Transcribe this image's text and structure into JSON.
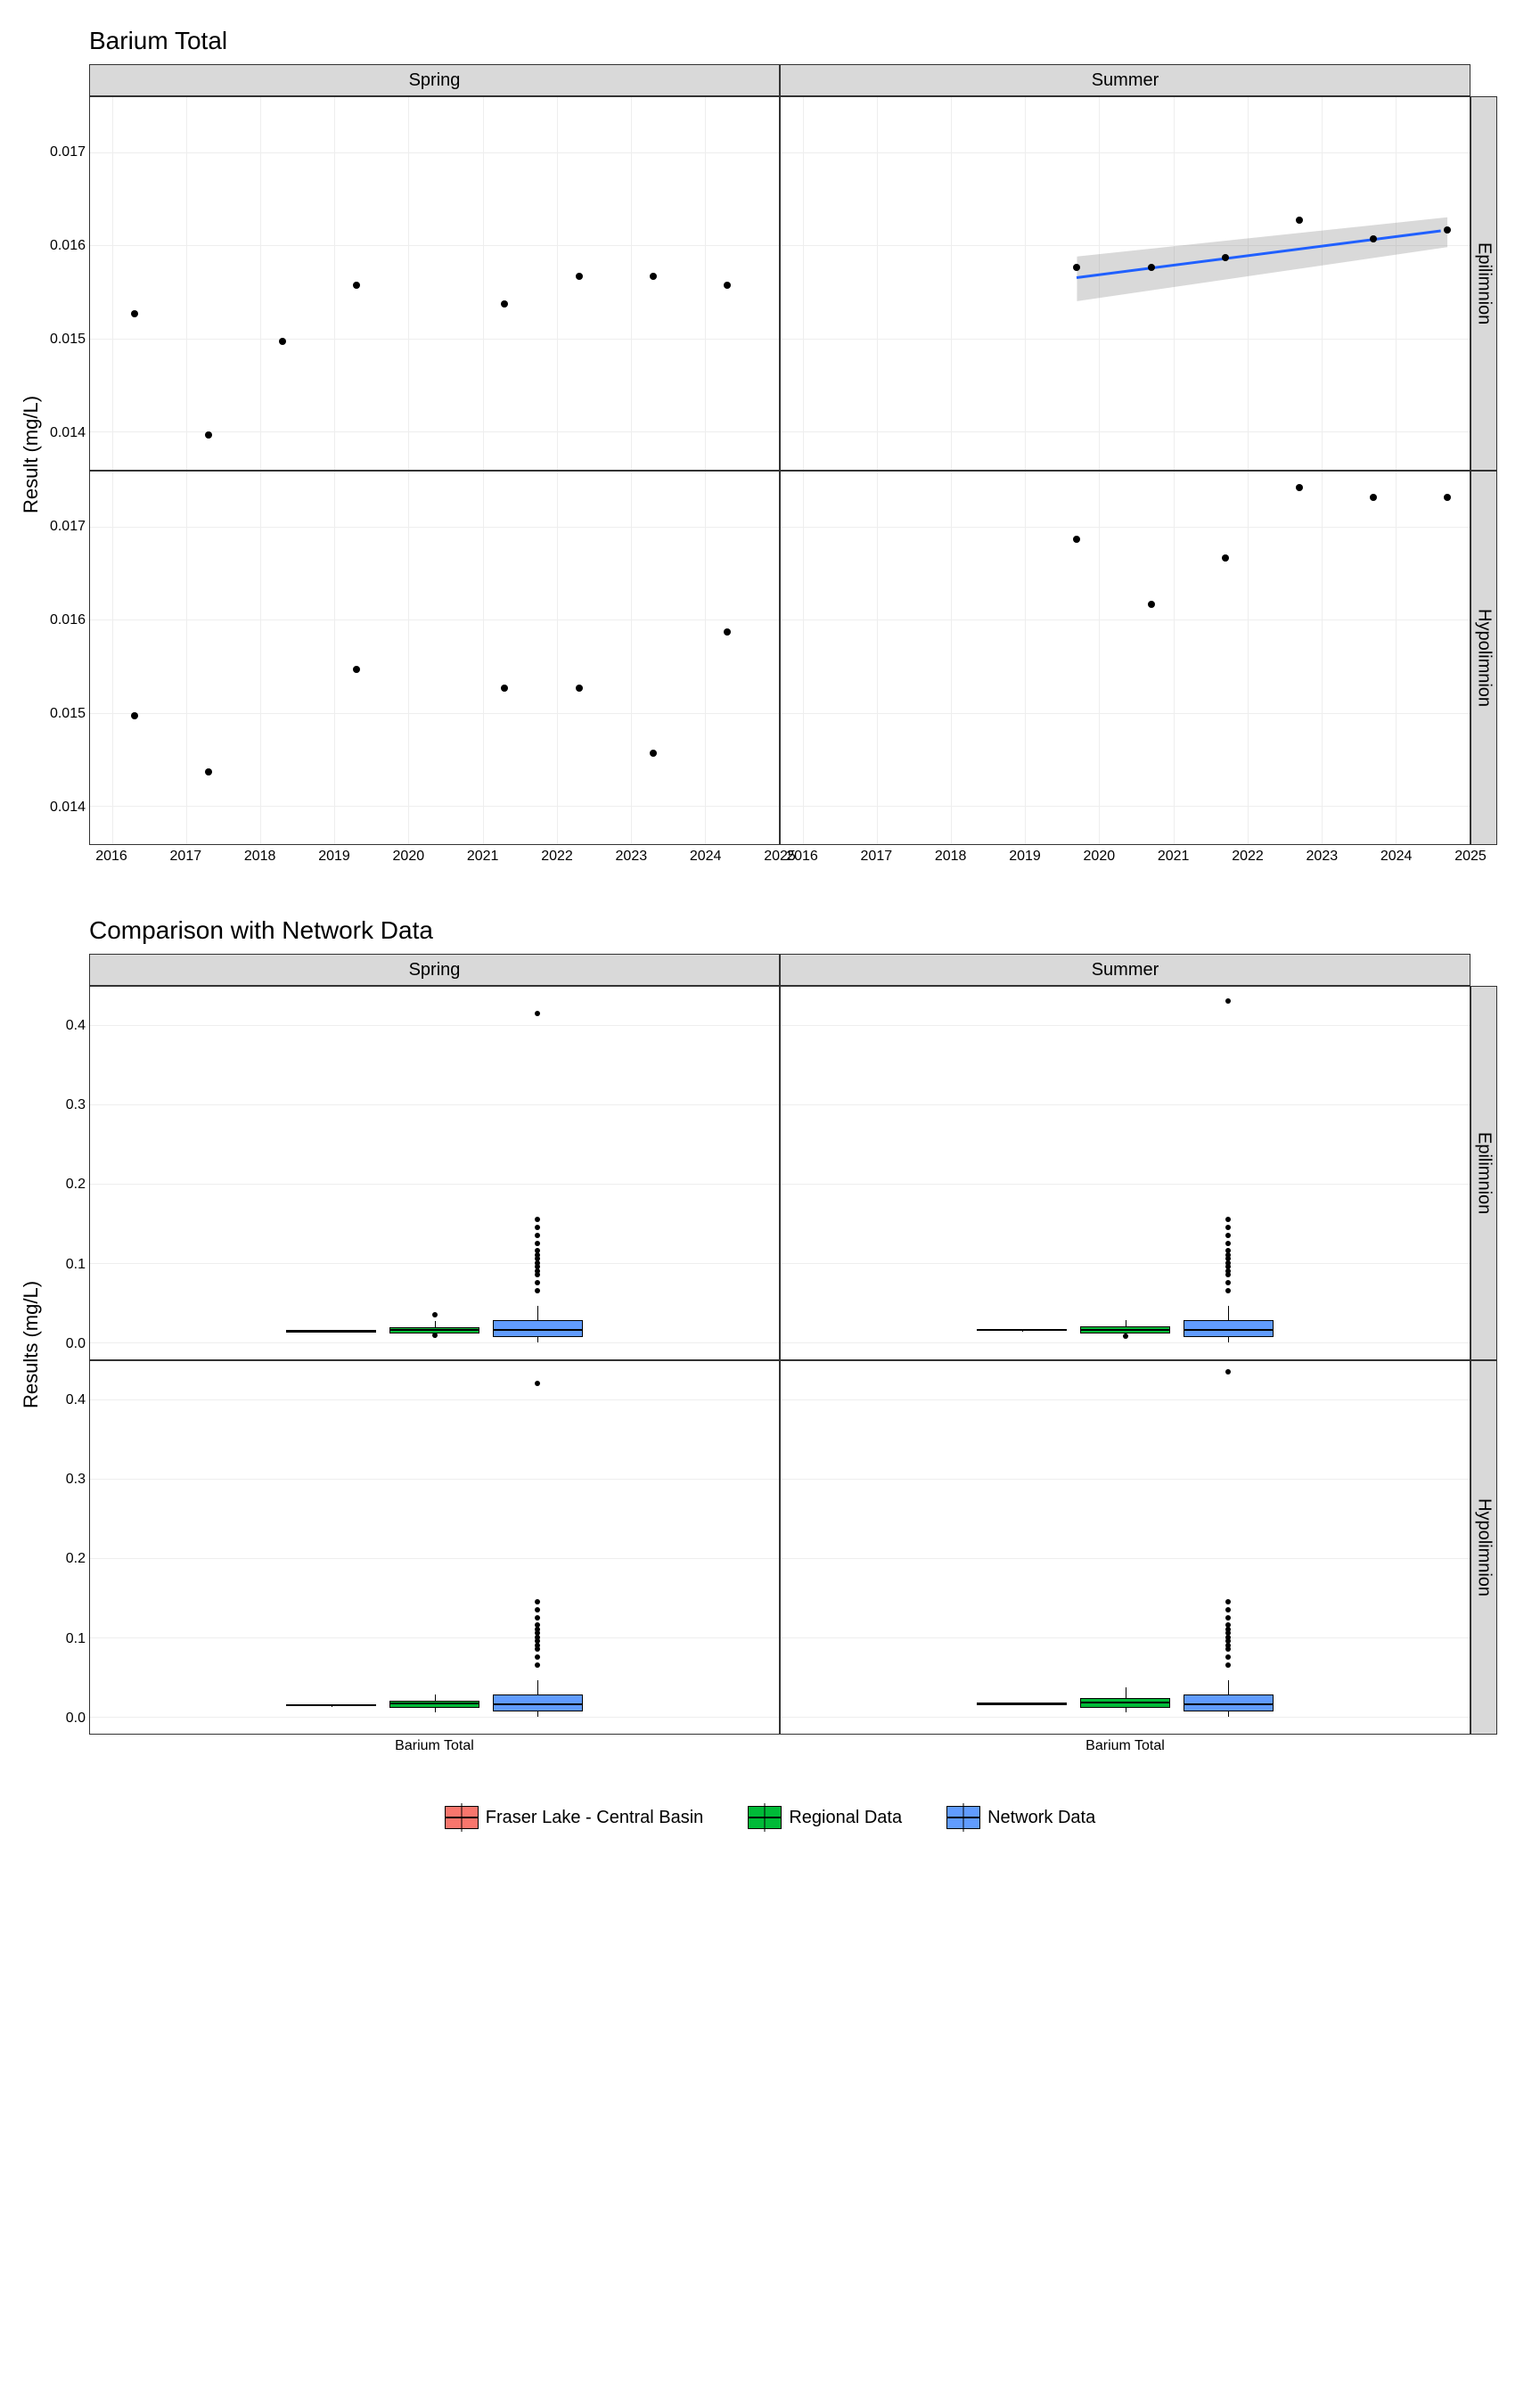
{
  "chart_data": [
    {
      "type": "scatter",
      "title": "Barium Total",
      "ylabel": "Result (mg/L)",
      "facets": {
        "cols": [
          "Spring",
          "Summer"
        ],
        "rows": [
          "Epilimnion",
          "Hypolimnion"
        ]
      },
      "x_range": [
        2015.7,
        2025.0
      ],
      "x_ticks": [
        2016,
        2017,
        2018,
        2019,
        2020,
        2021,
        2022,
        2023,
        2024,
        2025
      ],
      "panels": {
        "Spring|Epilimnion": {
          "y_range": [
            0.0136,
            0.0176
          ],
          "y_ticks": [
            0.014,
            0.015,
            0.016,
            0.017
          ],
          "points": [
            {
              "x": 2016.3,
              "y": 0.0152
            },
            {
              "x": 2017.3,
              "y": 0.0139
            },
            {
              "x": 2018.3,
              "y": 0.0149
            },
            {
              "x": 2019.3,
              "y": 0.0155
            },
            {
              "x": 2021.3,
              "y": 0.0153
            },
            {
              "x": 2022.3,
              "y": 0.0156
            },
            {
              "x": 2023.3,
              "y": 0.0156
            },
            {
              "x": 2024.3,
              "y": 0.0155
            }
          ]
        },
        "Summer|Epilimnion": {
          "y_range": [
            0.0136,
            0.0176
          ],
          "y_ticks": [
            0.014,
            0.015,
            0.016,
            0.017
          ],
          "points": [
            {
              "x": 2019.7,
              "y": 0.0157
            },
            {
              "x": 2020.7,
              "y": 0.0157
            },
            {
              "x": 2021.7,
              "y": 0.0158
            },
            {
              "x": 2022.7,
              "y": 0.0162
            },
            {
              "x": 2023.7,
              "y": 0.016
            },
            {
              "x": 2024.7,
              "y": 0.0161
            }
          ],
          "trend": {
            "x0": 2019.7,
            "y0": 0.01565,
            "x1": 2024.7,
            "y1": 0.01615
          },
          "confidence": true
        },
        "Spring|Hypolimnion": {
          "y_range": [
            0.0136,
            0.0176
          ],
          "y_ticks": [
            0.014,
            0.015,
            0.016,
            0.017
          ],
          "points": [
            {
              "x": 2016.3,
              "y": 0.0149
            },
            {
              "x": 2017.3,
              "y": 0.0143
            },
            {
              "x": 2019.3,
              "y": 0.0154
            },
            {
              "x": 2021.3,
              "y": 0.0152
            },
            {
              "x": 2022.3,
              "y": 0.0152
            },
            {
              "x": 2023.3,
              "y": 0.0145
            },
            {
              "x": 2024.3,
              "y": 0.0158
            }
          ]
        },
        "Summer|Hypolimnion": {
          "y_range": [
            0.0136,
            0.0176
          ],
          "y_ticks": [
            0.014,
            0.015,
            0.016,
            0.017
          ],
          "points": [
            {
              "x": 2019.7,
              "y": 0.0168
            },
            {
              "x": 2020.7,
              "y": 0.0161
            },
            {
              "x": 2021.7,
              "y": 0.0166
            },
            {
              "x": 2022.7,
              "y": 0.01735
            },
            {
              "x": 2023.7,
              "y": 0.01725
            },
            {
              "x": 2024.7,
              "y": 0.01725
            }
          ]
        }
      }
    },
    {
      "type": "boxplot",
      "title": "Comparison with Network Data",
      "ylabel": "Results (mg/L)",
      "facets": {
        "cols": [
          "Spring",
          "Summer"
        ],
        "rows": [
          "Epilimnion",
          "Hypolimnion"
        ]
      },
      "x_category": "Barium Total",
      "y_range": [
        -0.02,
        0.45
      ],
      "y_ticks": [
        0.0,
        0.1,
        0.2,
        0.3,
        0.4
      ],
      "series": [
        {
          "name": "Fraser Lake - Central Basin",
          "color": "#f8766d"
        },
        {
          "name": "Regional Data",
          "color": "#00ba38"
        },
        {
          "name": "Network Data",
          "color": "#619cff"
        }
      ],
      "panels": {
        "Spring|Epilimnion": {
          "boxes": [
            {
              "series": "Fraser Lake - Central Basin",
              "q1": 0.014,
              "med": 0.0154,
              "q3": 0.0156,
              "low": 0.014,
              "high": 0.016,
              "outliers": []
            },
            {
              "series": "Regional Data",
              "q1": 0.013,
              "med": 0.016,
              "q3": 0.02,
              "low": 0.007,
              "high": 0.028,
              "outliers": [
                0.03,
                0.004
              ]
            },
            {
              "series": "Network Data",
              "q1": 0.008,
              "med": 0.016,
              "q3": 0.03,
              "low": 0.001,
              "high": 0.048,
              "outliers": [
                0.06,
                0.07,
                0.08,
                0.085,
                0.09,
                0.095,
                0.1,
                0.105,
                0.11,
                0.12,
                0.13,
                0.14,
                0.15,
                0.41
              ]
            }
          ]
        },
        "Summer|Epilimnion": {
          "boxes": [
            {
              "series": "Fraser Lake - Central Basin",
              "q1": 0.0157,
              "med": 0.0159,
              "q3": 0.0161,
              "low": 0.0157,
              "high": 0.0162,
              "outliers": []
            },
            {
              "series": "Regional Data",
              "q1": 0.013,
              "med": 0.016,
              "q3": 0.022,
              "low": 0.007,
              "high": 0.03,
              "outliers": [
                0.002
              ]
            },
            {
              "series": "Network Data",
              "q1": 0.008,
              "med": 0.016,
              "q3": 0.03,
              "low": 0.001,
              "high": 0.048,
              "outliers": [
                0.06,
                0.07,
                0.08,
                0.085,
                0.09,
                0.095,
                0.1,
                0.105,
                0.11,
                0.12,
                0.13,
                0.14,
                0.15,
                0.425
              ]
            }
          ]
        },
        "Spring|Hypolimnion": {
          "boxes": [
            {
              "series": "Fraser Lake - Central Basin",
              "q1": 0.0145,
              "med": 0.0152,
              "q3": 0.0154,
              "low": 0.0143,
              "high": 0.0158,
              "outliers": []
            },
            {
              "series": "Regional Data",
              "q1": 0.013,
              "med": 0.017,
              "q3": 0.022,
              "low": 0.007,
              "high": 0.03,
              "outliers": []
            },
            {
              "series": "Network Data",
              "q1": 0.008,
              "med": 0.016,
              "q3": 0.03,
              "low": 0.001,
              "high": 0.048,
              "outliers": [
                0.06,
                0.07,
                0.08,
                0.085,
                0.09,
                0.095,
                0.1,
                0.105,
                0.11,
                0.12,
                0.13,
                0.14,
                0.415
              ]
            }
          ]
        },
        "Summer|Hypolimnion": {
          "boxes": [
            {
              "series": "Fraser Lake - Central Basin",
              "q1": 0.0163,
              "med": 0.0169,
              "q3": 0.0173,
              "low": 0.0161,
              "high": 0.0174,
              "outliers": []
            },
            {
              "series": "Regional Data",
              "q1": 0.013,
              "med": 0.018,
              "q3": 0.025,
              "low": 0.007,
              "high": 0.038,
              "outliers": []
            },
            {
              "series": "Network Data",
              "q1": 0.008,
              "med": 0.016,
              "q3": 0.03,
              "low": 0.001,
              "high": 0.048,
              "outliers": [
                0.06,
                0.07,
                0.08,
                0.085,
                0.09,
                0.095,
                0.1,
                0.105,
                0.11,
                0.12,
                0.13,
                0.14,
                0.43
              ]
            }
          ]
        }
      }
    }
  ],
  "legend": [
    "Fraser Lake - Central Basin",
    "Regional Data",
    "Network Data"
  ],
  "legend_colors": [
    "#f8766d",
    "#00ba38",
    "#619cff"
  ]
}
